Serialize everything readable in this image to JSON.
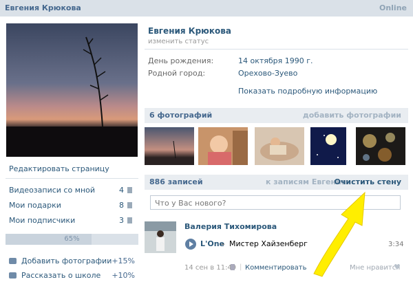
{
  "header": {
    "name": "Евгения Крюкова",
    "online": "Online"
  },
  "left": {
    "edit_page": "Редактировать страницу",
    "items": [
      {
        "label": "Видеозаписи со мной",
        "count": "4"
      },
      {
        "label": "Мои подарки",
        "count": "8"
      },
      {
        "label": "Мои подписчики",
        "count": "3"
      }
    ],
    "progress": {
      "label": "65%",
      "value": 65
    },
    "actions": [
      {
        "label": "Добавить фотографии",
        "bonus": "+15%"
      },
      {
        "label": "Рассказать о школе",
        "bonus": "+10%"
      }
    ]
  },
  "profile": {
    "name": "Евгения Крюкова",
    "status": "изменить статус",
    "birthday_label": "День рождения:",
    "birthday_value": "14 октября 1990 г.",
    "city_label": "Родной город:",
    "city_value": "Орехово-Зуево",
    "more_info": "Показать подробную информацию"
  },
  "photos": {
    "title": "6 фотографий",
    "add": "добавить фотографии"
  },
  "wall": {
    "title": "886 записей",
    "to_records": "к записям Евгении",
    "clear": "Очистить стену",
    "placeholder": "Что у Вас нового?"
  },
  "post": {
    "author": "Валерия Тихомирова",
    "artist": "L'One",
    "dash": "–",
    "song": "Мистер Хайзенберг",
    "duration": "3:34",
    "time": "14 сен в 11:49",
    "comment": "Комментировать",
    "like": "Мне нравится"
  },
  "colors": {
    "accent": "#2b587a",
    "arrow": "#ffee00"
  }
}
